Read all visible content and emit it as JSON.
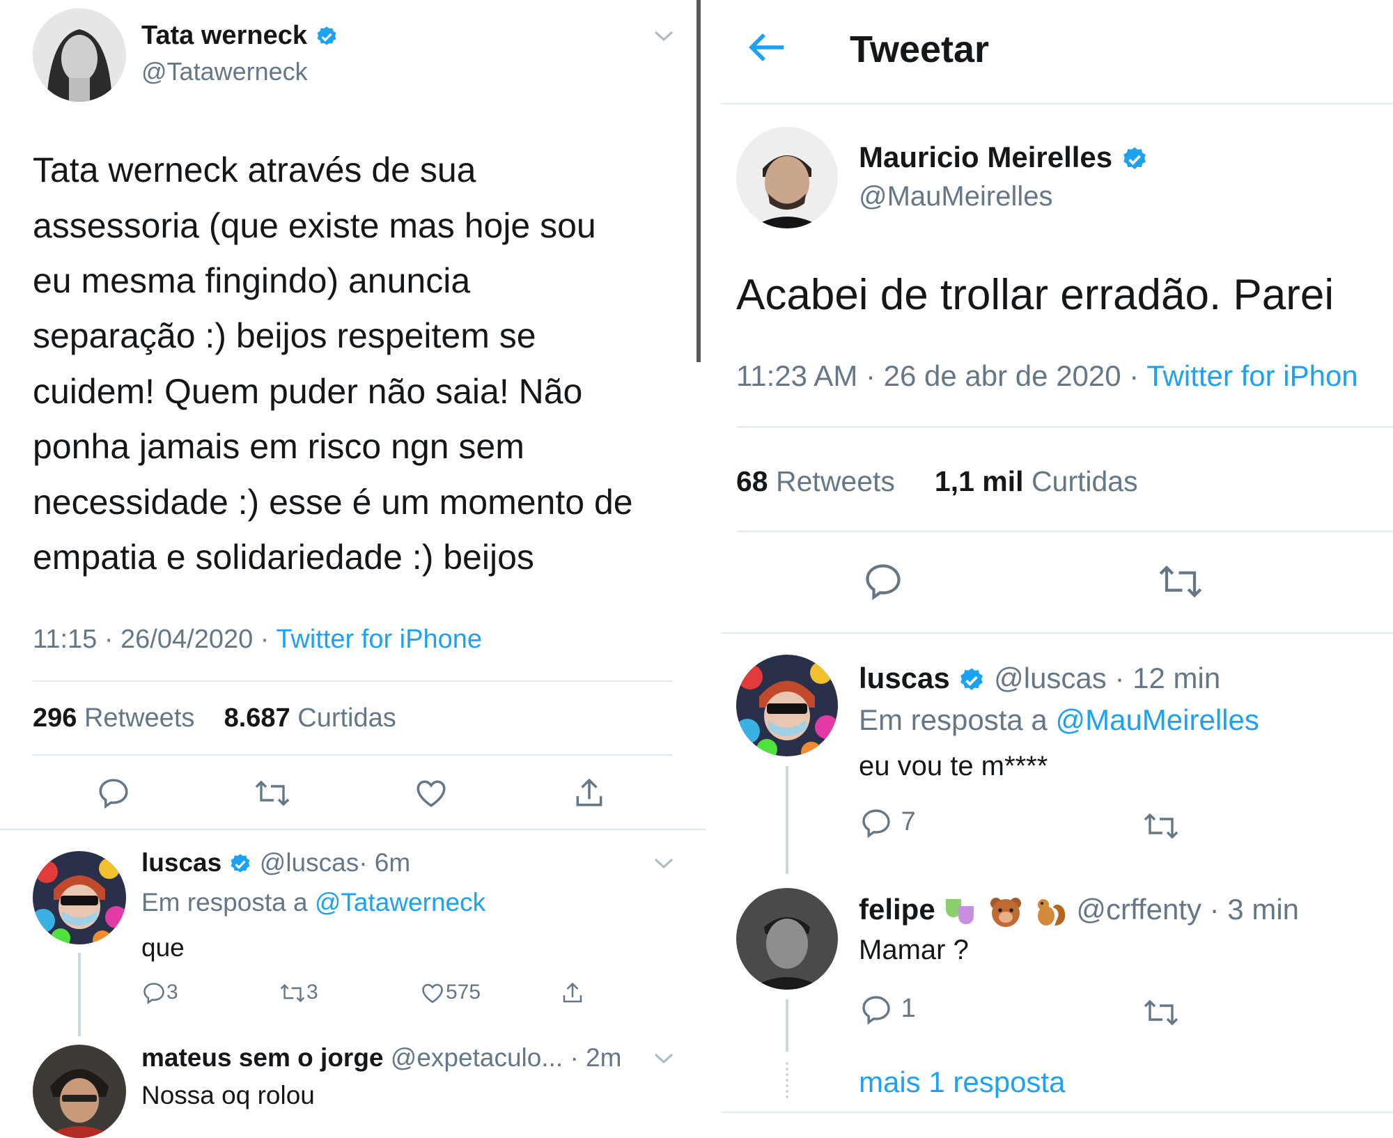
{
  "left": {
    "author": {
      "name": "Tata werneck",
      "handle": "@Tatawerneck"
    },
    "tweet_lines": [
      "Tata werneck através de sua",
      "assessoria (que existe mas hoje sou",
      "eu mesma fingindo) anuncia",
      "separação :) beijos respeitem se",
      "cuidem! Quem puder não saia! Não",
      "ponha jamais em risco ngn sem",
      "necessidade :) esse é um momento de",
      "empatia e solidariedade :) beijos"
    ],
    "meta": {
      "time": "11:15 · 26/04/2020 · ",
      "source": "Twitter for iPhone"
    },
    "stats": {
      "retweets_count": "296",
      "retweets_label": "Retweets",
      "likes_count": "8.687",
      "likes_label": "Curtidas"
    },
    "replies": [
      {
        "name": "luscas",
        "handle": "@luscas",
        "time": "· 6m",
        "reply_to_label": "Em resposta a",
        "reply_to_handle": "@Tatawerneck",
        "text": "que",
        "reply_count": "3",
        "retweet_count": "3",
        "like_count": "575"
      },
      {
        "name": "mateus sem o jorge",
        "handle": "@expetaculo...",
        "time": "· 2m",
        "text": "Nossa oq rolou"
      }
    ]
  },
  "right": {
    "header": {
      "title": "Tweetar"
    },
    "author": {
      "name": "Mauricio Meirelles",
      "handle": "@MauMeirelles"
    },
    "tweet_text": "Acabei de trollar erradão. Parei",
    "meta": {
      "time": "11:23 AM · 26 de abr de 2020 · ",
      "source": "Twitter for iPhon"
    },
    "stats": {
      "retweets_count": "68",
      "retweets_label": "Retweets",
      "likes_count": "1,1 mil",
      "likes_label": "Curtidas"
    },
    "replies": [
      {
        "name": "luscas",
        "handle": "@luscas",
        "time": "· 12 min",
        "reply_to_label": "Em resposta a",
        "reply_to_handle": "@MauMeirelles",
        "text": "eu vou te m****",
        "reply_count": "7"
      },
      {
        "name": "felipe",
        "handle": "@crffenty",
        "time": "· 3 min",
        "text": "Mamar ?",
        "reply_count": "1"
      }
    ],
    "more_replies": "mais 1 resposta"
  }
}
